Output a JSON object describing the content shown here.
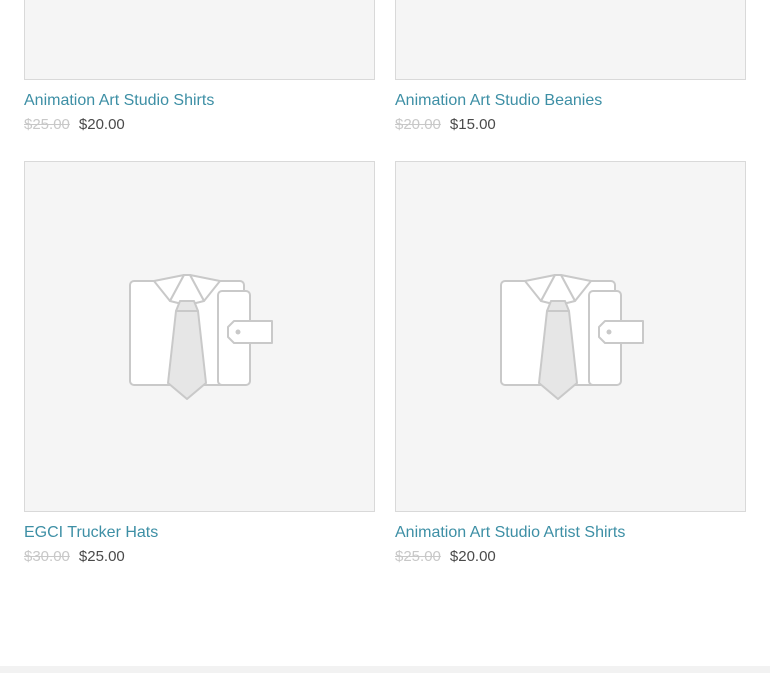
{
  "products": [
    {
      "title": "Animation Art Studio Shirts",
      "compare_price": "$25.00",
      "price": "$20.00",
      "image": "placeholder-shirt-icon"
    },
    {
      "title": "Animation Art Studio Beanies",
      "compare_price": "$20.00",
      "price": "$15.00",
      "image": "placeholder-shirt-icon"
    },
    {
      "title": "EGCI Trucker Hats",
      "compare_price": "$30.00",
      "price": "$25.00",
      "image": "placeholder-shirt-icon"
    },
    {
      "title": "Animation Art Studio Artist Shirts",
      "compare_price": "$25.00",
      "price": "$20.00",
      "image": "placeholder-shirt-icon"
    }
  ],
  "colors": {
    "link": "#3d8fa5",
    "compare_price": "#c8c8c8",
    "price": "#4a4a4a",
    "image_bg": "#f5f5f5",
    "image_border": "#d9d9d9",
    "placeholder_fill": "#ffffff",
    "placeholder_stroke": "#c9c9c9",
    "tie_fill": "#e6e6e6"
  }
}
